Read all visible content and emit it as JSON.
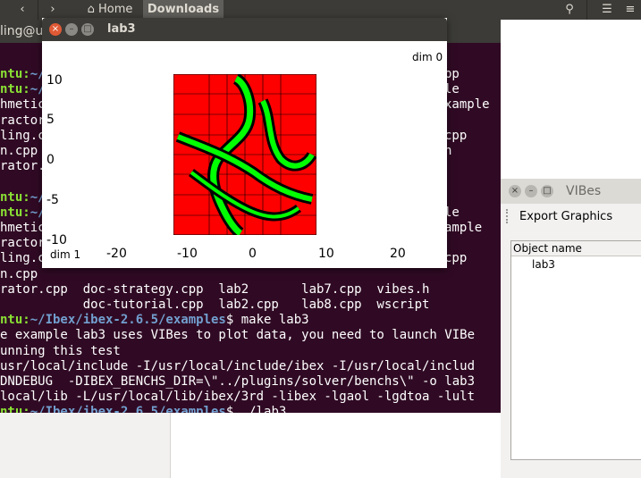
{
  "file_manager": {
    "back_icon": "chevron-left-icon",
    "forward_icon": "chevron-right-icon",
    "home_label": "Home",
    "downloads_label": "Downloads",
    "search_icon": "search-icon",
    "list_icon": "list-view-icon",
    "menu_icon": "menu-icon"
  },
  "terminal": {
    "title_fragment": "ling@u",
    "lines": [
      {
        "prompt": "ntu:",
        "path": "~/",
        "text": ""
      },
      {
        "prompt": "ntu:",
        "path": "~/",
        "text": ""
      },
      {
        "prompt": "",
        "path": "",
        "text": "hmetic"
      },
      {
        "prompt": "",
        "path": "",
        "text": "ractor"
      },
      {
        "prompt": "",
        "path": "",
        "text": "ling.c"
      },
      {
        "prompt": "",
        "path": "",
        "text": "n.cpp"
      },
      {
        "prompt": "",
        "path": "",
        "text": "rator."
      },
      {
        "prompt": "",
        "path": "",
        "text": ""
      },
      {
        "prompt": "ntu:",
        "path": "~/",
        "text": ""
      },
      {
        "prompt": "ntu:",
        "path": "~/",
        "text": ""
      },
      {
        "prompt": "",
        "path": "",
        "text": "hmetic"
      },
      {
        "prompt": "",
        "path": "",
        "text": "ractor"
      },
      {
        "prompt": "",
        "path": "",
        "text": "ling.c"
      },
      {
        "prompt": "",
        "path": "",
        "text": "n.cpp"
      },
      {
        "prompt": "",
        "path": "",
        "text": "rator.cpp  doc-strategy.cpp  lab2       lab7.cpp  vibes.h"
      },
      {
        "prompt": "",
        "path": "",
        "text": "           doc-tutorial.cpp  lab2.cpp   lab8.cpp  wscript"
      },
      {
        "prompt": "ntu:",
        "path": "~/Ibex/ibex-2.6.5/examples",
        "text": "$ make lab3"
      },
      {
        "prompt": "",
        "path": "",
        "text": "e example lab3 uses VIBes to plot data, you need to launch VIBe"
      },
      {
        "prompt": "",
        "path": "",
        "text": "unning this test"
      },
      {
        "prompt": "",
        "path": "",
        "text": "usr/local/include -I/usr/local/include/ibex -I/usr/local/includ"
      },
      {
        "prompt": "",
        "path": "",
        "text": "DNDEBUG  -DIBEX_BENCHS_DIR=\\\"../plugins/solver/benchs\\\" -o lab3"
      },
      {
        "prompt": "",
        "path": "",
        "text": "local/lib -L/usr/local/lib/ibex/3rd -libex -lgaol -lgdtoa -lult"
      },
      {
        "prompt": "ntu:",
        "path": "~/Ibex/ibex-2.6.5/examples",
        "text": "$ ./lab3"
      },
      {
        "prompt": "ntu:",
        "path": "~/Ibex/ibex-2.6.5/examples",
        "text": "$ "
      }
    ],
    "right_column": [
      "wscript",
      "le",
      "ample",
      "cpp",
      "h",
      "le",
      "ample",
      "cpp"
    ],
    "mid_column": [
      "",
      "",
      "pp",
      "pp",
      "pp",
      "pp",
      "",
      "",
      "",
      "pp",
      "pp",
      "pp",
      "pp"
    ],
    "far_right": [
      "wscript",
      "",
      "",
      "",
      "",
      "",
      "",
      "",
      "",
      "",
      "",
      "",
      ""
    ]
  },
  "lab3_window": {
    "title": "lab3",
    "close_label": "×",
    "dim0_label": "dim 0",
    "dim1_label": "dim 1",
    "y_ticks": [
      "10",
      "5",
      "0",
      "-5",
      "-10"
    ],
    "x_ticks": [
      "-20",
      "-10",
      "0",
      "10",
      "20"
    ]
  },
  "vibes_window": {
    "title": "VIBes",
    "export_label": "Export Graphics",
    "column_header": "Object name",
    "items": [
      "lab3"
    ]
  },
  "colors": {
    "terminal_bg": "#300a24",
    "prompt_green": "#8ae234",
    "path_blue": "#729fcf",
    "plot_outside": "#ff0000",
    "plot_inside": "#00ff00",
    "plot_boundary": "#000000"
  }
}
